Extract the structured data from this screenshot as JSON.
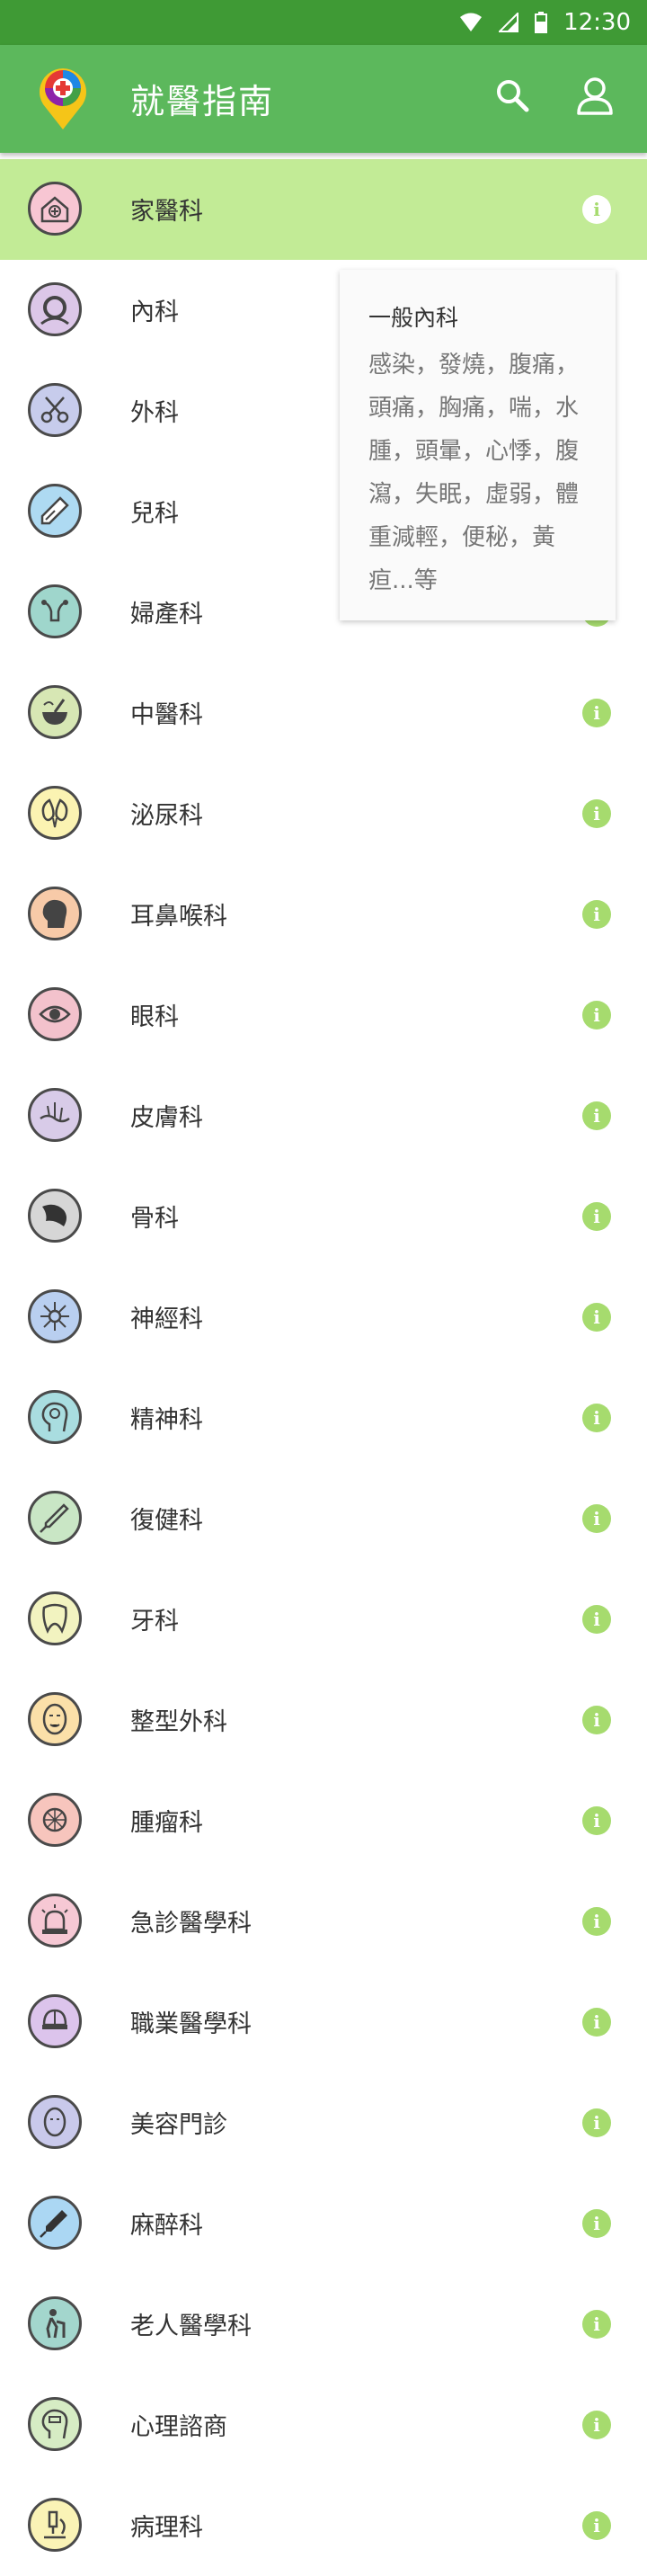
{
  "status_bar": {
    "time": "12:30"
  },
  "app_bar": {
    "title": "就醫指南"
  },
  "colors": {
    "primary": "#5cb85c",
    "status": "#3f9a35",
    "selected": "#c2eb96",
    "info": "#a6db6e"
  },
  "tooltip": {
    "title": "一般內科",
    "body": "感染，發燒，腹痛，頭痛，胸痛，喘，水腫，頭暈，心悸，腹瀉，失眠，虛弱，體重減輕，便秘，黃疸...等"
  },
  "departments": [
    {
      "label": "家醫科",
      "icon": "house-icon",
      "color": "#f7c6d3",
      "selected": true
    },
    {
      "label": "內科",
      "icon": "magnifier-icon",
      "color": "#dcc7e8"
    },
    {
      "label": "外科",
      "icon": "scissors-icon",
      "color": "#c7ccec"
    },
    {
      "label": "兒科",
      "icon": "syringe-icon",
      "color": "#aedaf2"
    },
    {
      "label": "婦產科",
      "icon": "uterus-icon",
      "color": "#9fd6cc"
    },
    {
      "label": "中醫科",
      "icon": "mortar-icon",
      "color": "#d7e7b4"
    },
    {
      "label": "泌尿科",
      "icon": "kidney-icon",
      "color": "#fbf3b2"
    },
    {
      "label": "耳鼻喉科",
      "icon": "head-profile-icon",
      "color": "#f7caa8"
    },
    {
      "label": "眼科",
      "icon": "eye-icon",
      "color": "#f3c2cc"
    },
    {
      "label": "皮膚科",
      "icon": "skin-icon",
      "color": "#d8cbe8"
    },
    {
      "label": "骨科",
      "icon": "bone-icon",
      "color": "#d6d6d6"
    },
    {
      "label": "神經科",
      "icon": "neuron-icon",
      "color": "#b9cff0"
    },
    {
      "label": "精神科",
      "icon": "mind-icon",
      "color": "#a9dde0"
    },
    {
      "label": "復健科",
      "icon": "needle-icon",
      "color": "#c9e6c5"
    },
    {
      "label": "牙科",
      "icon": "tooth-icon",
      "color": "#f2f3c0"
    },
    {
      "label": "整型外科",
      "icon": "face-icon",
      "color": "#fbe0a9"
    },
    {
      "label": "腫瘤科",
      "icon": "tumor-icon",
      "color": "#f7c5bd"
    },
    {
      "label": "急診醫學科",
      "icon": "siren-icon",
      "color": "#f6c8d4"
    },
    {
      "label": "職業醫學科",
      "icon": "helmet-icon",
      "color": "#dcc4ec"
    },
    {
      "label": "美容門診",
      "icon": "beauty-face-icon",
      "color": "#c9c9eb"
    },
    {
      "label": "麻醉科",
      "icon": "anesthesia-syringe-icon",
      "color": "#abd7f3"
    },
    {
      "label": "老人醫學科",
      "icon": "elderly-icon",
      "color": "#a3d6cd"
    },
    {
      "label": "心理諮商",
      "icon": "counseling-icon",
      "color": "#d6ecc4"
    },
    {
      "label": "病理科",
      "icon": "microscope-icon",
      "color": "#faf3b6"
    }
  ]
}
